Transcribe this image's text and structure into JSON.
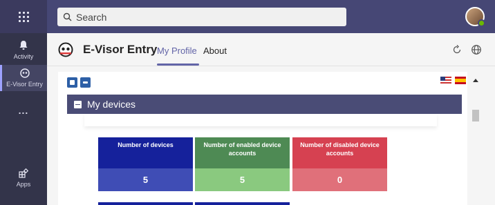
{
  "topbar": {
    "search_placeholder": "Search"
  },
  "rail": {
    "items": [
      {
        "label": "Activity",
        "icon": "bell-icon"
      },
      {
        "label": "E-Visor Entry",
        "icon": "evisor-icon"
      },
      {
        "label": "...",
        "icon": "more-icon"
      },
      {
        "label": "Apps",
        "icon": "apps-icon"
      }
    ]
  },
  "app": {
    "title": "E-Visor Entry",
    "tabs": [
      {
        "label": "My Profile",
        "active": true
      },
      {
        "label": "About",
        "active": false
      }
    ]
  },
  "content": {
    "section_title": "My devices",
    "cards": [
      {
        "label": "Number of devices",
        "value": "5",
        "color": "#15219b"
      },
      {
        "label": "Number of enabled device accounts",
        "value": "5",
        "color": "#4e8a54"
      },
      {
        "label": "Number of disabled device accounts",
        "value": "0",
        "color": "#d64151"
      }
    ]
  },
  "colors": {
    "accent": "#6264a7",
    "topbar": "#464775",
    "rail": "#33344a"
  }
}
